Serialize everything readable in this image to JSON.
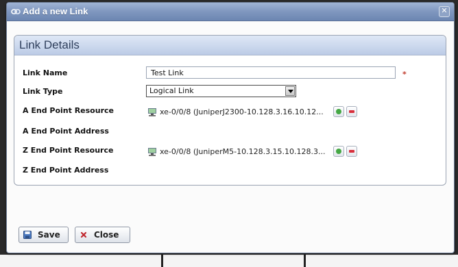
{
  "dialog": {
    "title": "Add a new Link",
    "close_glyph": "✕"
  },
  "panel": {
    "title": "Link Details"
  },
  "fields": {
    "link_name": {
      "label": "Link Name",
      "value": "Test Link",
      "required_glyph": "⁎"
    },
    "link_type": {
      "label": "Link Type",
      "value": "Logical Link"
    },
    "a_end_resource": {
      "label": "A End Point Resource",
      "value": "xe-0/0/8 (JuniperJ2300-10.128.3.16.10.12..."
    },
    "a_end_address": {
      "label": "A End Point Address"
    },
    "z_end_resource": {
      "label": "Z End Point Resource",
      "value": "xe-0/0/8 (JuniperM5-10.128.3.15.10.128.3..."
    },
    "z_end_address": {
      "label": "Z End Point Address"
    }
  },
  "buttons": {
    "save": "Save",
    "close": "Close"
  },
  "icons": {
    "title": "link-icon",
    "resource": "network-device-icon",
    "add": "add-icon",
    "remove": "remove-icon",
    "save": "floppy-disk-icon",
    "close": "x-icon"
  },
  "colors": {
    "titlebar": "#7f97bf",
    "panel_header": "#bccbe6",
    "add": "#45a845",
    "remove": "#d8303d"
  }
}
